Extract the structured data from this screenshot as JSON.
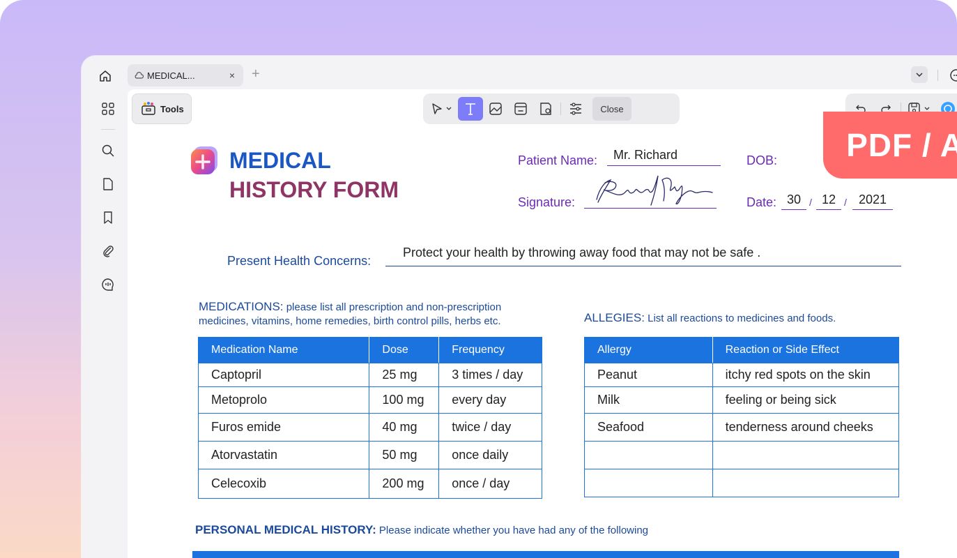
{
  "tabs": {
    "home_icon": "home-icon",
    "active_title": "MEDICAL...",
    "close": "×",
    "new_tab": "+"
  },
  "tools": {
    "label": "Tools"
  },
  "toolbar": {
    "close_label": "Close"
  },
  "badge": {
    "text": "PDF / A"
  },
  "form": {
    "title_line1": "MEDICAL",
    "title_line2": "HISTORY FORM",
    "patient_label": "Patient Name:",
    "patient_value": "Mr. Richard",
    "dob_label": "DOB:",
    "signature_label": "Signature:",
    "signature_value": "Richard Nixon",
    "date_label": "Date:",
    "date_day": "30",
    "date_month": "12",
    "date_year": "2021",
    "date_sep": "/",
    "concerns_label": "Present Health Concerns:",
    "concerns_value": "Protect your health by throwing away food that may not be safe .",
    "medications_title": "MEDICATIONS:",
    "medications_desc": " please list all prescription and non-prescription medicines, vitamins, home remedies, birth control pills, herbs etc.",
    "allergies_title": "ALLEGIES:",
    "allergies_desc": " List all reactions to medicines and foods.",
    "pmh_title": "PERSONAL MEDICAL HISTORY:",
    "pmh_desc": " Please indicate whether you have had any of the following"
  },
  "medications": {
    "headers": [
      "Medication Name",
      "Dose",
      "Frequency"
    ],
    "rows": [
      [
        "Captopril",
        "25 mg",
        "3 times / day"
      ],
      [
        "Metoprolo",
        "100 mg",
        "every day"
      ],
      [
        "Furos emide",
        "40 mg",
        "twice / day"
      ],
      [
        "Atorvastatin",
        "50 mg",
        "once daily"
      ],
      [
        "Celecoxib",
        "200 mg",
        "once / day"
      ]
    ]
  },
  "allergies": {
    "headers": [
      "Allergy",
      "Reaction or Side Effect"
    ],
    "rows": [
      [
        "Peanut",
        "itchy red spots on the skin"
      ],
      [
        "Milk",
        "feeling or being sick"
      ],
      [
        "Seafood",
        "tenderness around cheeks"
      ],
      [
        "",
        ""
      ],
      [
        "",
        ""
      ]
    ]
  },
  "colors": {
    "accent": "#7d7dfa",
    "table_header": "#1b73e0",
    "badge": "#ff6b6b",
    "title_blue": "#1a56c4",
    "title_plum": "#8e3566"
  }
}
